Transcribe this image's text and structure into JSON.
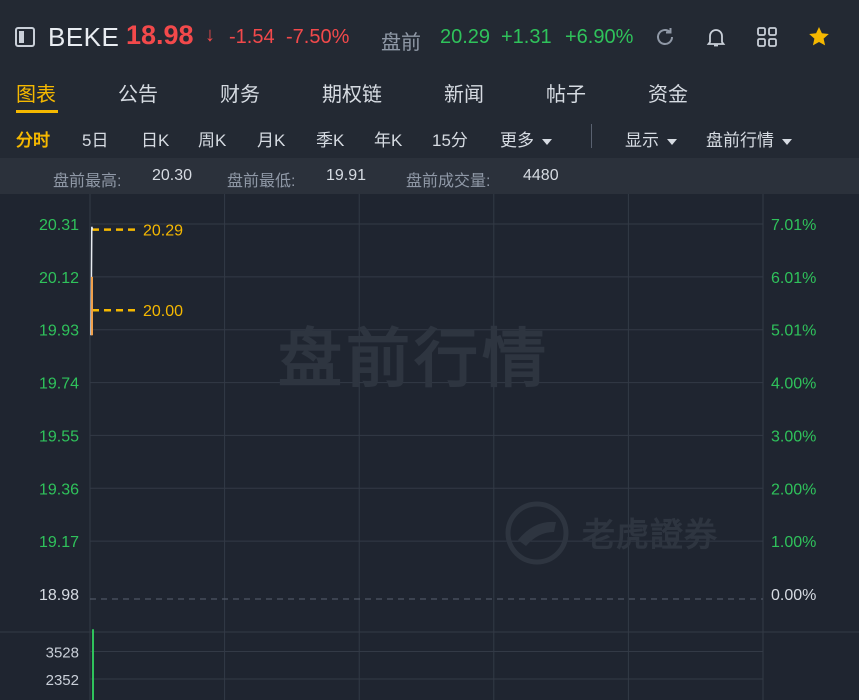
{
  "header": {
    "ticker": "BEKE",
    "last_price": "18.98",
    "change": "-1.54",
    "change_pct": "-7.50%",
    "pre_label": "盘前",
    "pre_price": "20.29",
    "pre_change": "+1.31",
    "pre_change_pct": "+6.90%",
    "icons": [
      "sidebar-toggle-icon",
      "refresh-icon",
      "bell-icon",
      "grid-icon",
      "star-icon"
    ]
  },
  "tabs": [
    {
      "label": "图表",
      "active": true
    },
    {
      "label": "公告"
    },
    {
      "label": "财务"
    },
    {
      "label": "期权链"
    },
    {
      "label": "新闻"
    },
    {
      "label": "帖子"
    },
    {
      "label": "资金"
    }
  ],
  "periods": [
    {
      "label": "分时",
      "active": true
    },
    {
      "label": "5日"
    },
    {
      "label": "日K"
    },
    {
      "label": "周K"
    },
    {
      "label": "月K"
    },
    {
      "label": "季K"
    },
    {
      "label": "年K"
    },
    {
      "label": "15分"
    },
    {
      "label": "更多"
    }
  ],
  "period_menus": {
    "display": "显示",
    "premarket": "盘前行情"
  },
  "stats": {
    "high_label": "盘前最高:",
    "high_value": "20.30",
    "low_label": "盘前最低:",
    "low_value": "19.91",
    "volume_label": "盘前成交量:",
    "volume_value": "4480"
  },
  "watermark": "盘前行情",
  "logo_text": "老虎證券",
  "colors": {
    "up": "#2fc25b",
    "down": "#f2494b",
    "accent": "#f5b800",
    "background": "#1f2530"
  },
  "chart_data": {
    "type": "line",
    "y_ticks_left": [
      "20.31",
      "20.12",
      "19.93",
      "19.74",
      "19.55",
      "19.36",
      "19.17",
      "18.98"
    ],
    "y_ticks_right": [
      "7.01%",
      "6.01%",
      "5.01%",
      "4.00%",
      "3.00%",
      "2.00%",
      "1.00%",
      "0.00%"
    ],
    "ylim": [
      18.98,
      20.31
    ],
    "reference_price": 18.98,
    "price_lines": [
      {
        "label": "20.29",
        "value": 20.29
      },
      {
        "label": "20.00",
        "value": 20.0
      }
    ],
    "series": [
      {
        "values": [
          19.91,
          20.3,
          20.29
        ]
      }
    ],
    "volume_ticks": [
      "3528",
      "2352"
    ],
    "volume_ylim": [
      0,
      4704
    ],
    "volume_bars": [
      4480
    ]
  }
}
